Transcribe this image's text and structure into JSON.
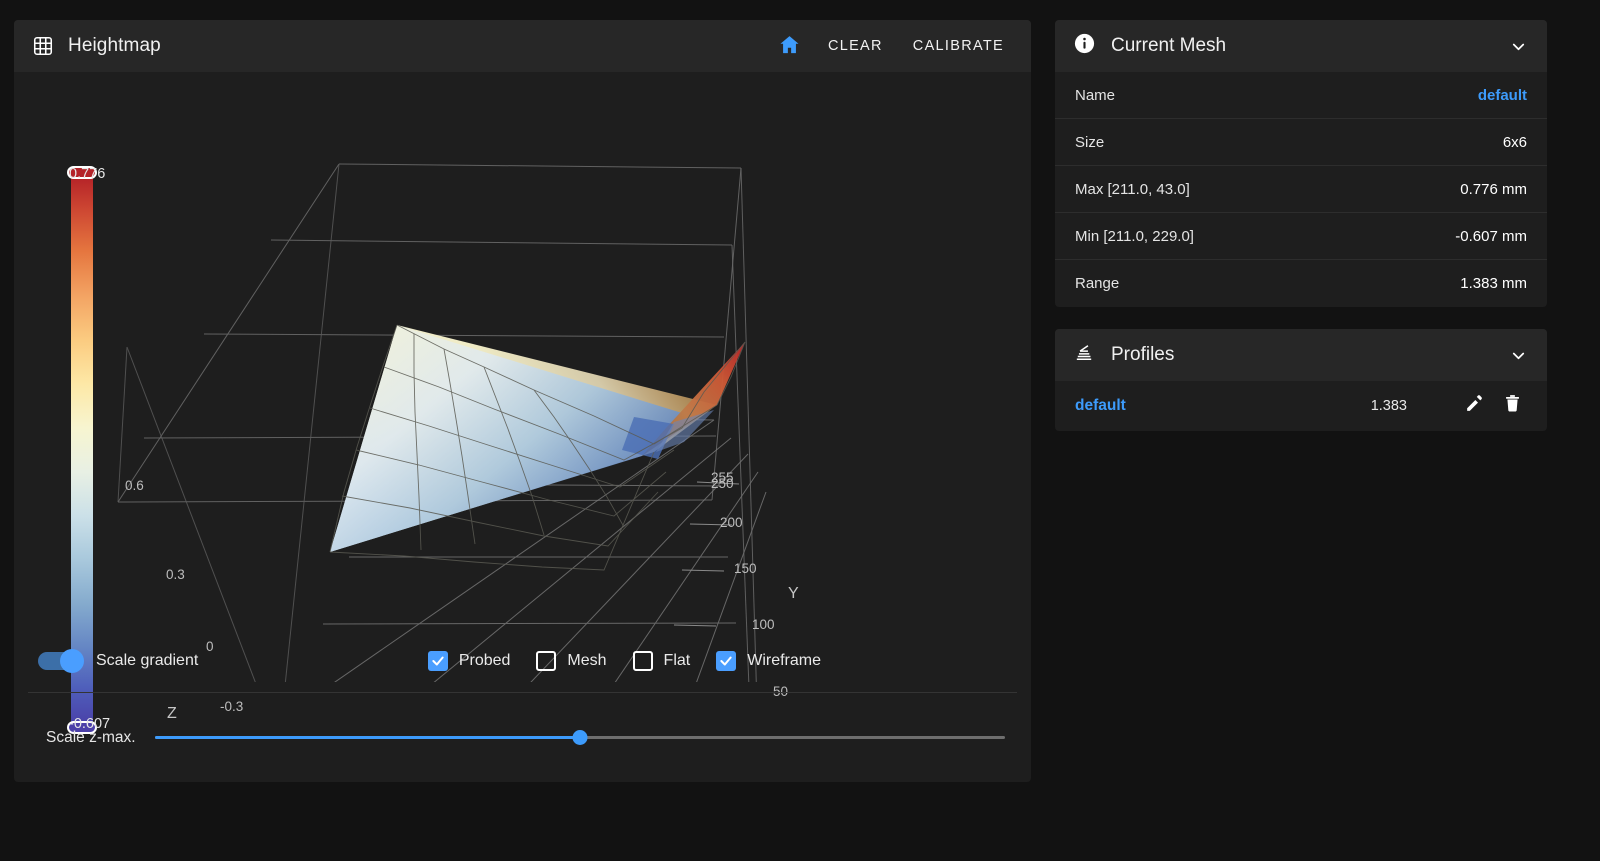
{
  "heightmap": {
    "title": "Heightmap",
    "icon": "grid-icon",
    "actions": {
      "home_icon": "home-icon",
      "clear_label": "CLEAR",
      "calibrate_label": "CALIBRATE"
    },
    "colorbar": {
      "max_label": "0.776",
      "min_label": "-0.607"
    },
    "controls": {
      "scale_gradient_label": "Scale gradient",
      "scale_gradient_on": true,
      "checkboxes": [
        {
          "label": "Probed",
          "checked": true
        },
        {
          "label": "Mesh",
          "checked": false
        },
        {
          "label": "Flat",
          "checked": false
        },
        {
          "label": "Wireframe",
          "checked": true
        }
      ],
      "slider_label": "Scale z-max.",
      "slider_percent": 50
    }
  },
  "chart_data": {
    "type": "surface",
    "title": "Heightmap",
    "xlabel": "",
    "ylabel": "Y",
    "zlabel": "Z",
    "colormap": "RdYlBu-reversed",
    "colorbar_range": [
      -0.607,
      0.776
    ],
    "z_ticks": [
      "0.6",
      "0.3",
      "0",
      "-0.3"
    ],
    "z_tick_values": [
      0.6,
      0.3,
      0,
      -0.3
    ],
    "y_ticks": [
      "255",
      "250",
      "200",
      "150",
      "100",
      "50"
    ],
    "y_tick_values": [
      255,
      250,
      200,
      150,
      100,
      50
    ],
    "grid": true,
    "wireframe": true,
    "mesh_size": "6x6",
    "z_min": -0.607,
    "z_max": 0.776,
    "z_range": 1.383,
    "max_position": [
      211.0,
      43.0
    ],
    "min_position": [
      211.0,
      229.0
    ]
  },
  "current_mesh": {
    "title": "Current Mesh",
    "icon": "info-icon",
    "collapse_icon": "chevron-down-icon",
    "rows": [
      {
        "key": "Name",
        "value": "default",
        "is_link": true
      },
      {
        "key": "Size",
        "value": "6x6",
        "is_link": false
      },
      {
        "key": "Max [211.0, 43.0]",
        "value": "0.776 mm",
        "is_link": false
      },
      {
        "key": "Min [211.0, 229.0]",
        "value": "-0.607 mm",
        "is_link": false
      },
      {
        "key": "Range",
        "value": "1.383 mm",
        "is_link": false
      }
    ]
  },
  "profiles": {
    "title": "Profiles",
    "icon": "layers-icon",
    "collapse_icon": "chevron-down-icon",
    "items": [
      {
        "name": "default",
        "value": "1.383",
        "edit_icon": "pencil-icon",
        "delete_icon": "trash-icon"
      }
    ]
  },
  "colors": {
    "accent": "#3d9bfb",
    "page_bg": "#121212",
    "card_bg": "#1e1e1e",
    "header_bg": "#272727"
  }
}
